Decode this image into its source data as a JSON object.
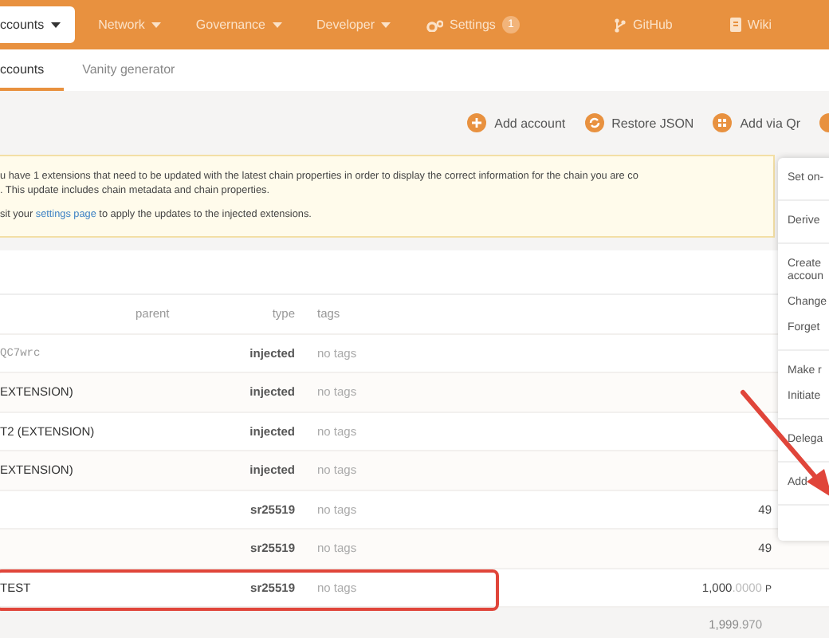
{
  "nav": {
    "items": [
      {
        "label": "ccounts",
        "kind": "dropdown",
        "selected": true
      },
      {
        "label": "Network",
        "kind": "dropdown",
        "selected": false
      },
      {
        "label": "Governance",
        "kind": "dropdown",
        "selected": false
      },
      {
        "label": "Developer",
        "kind": "dropdown",
        "selected": false
      },
      {
        "label": "Settings",
        "kind": "settings",
        "selected": false,
        "badge": "1"
      }
    ],
    "links": [
      {
        "label": "GitHub",
        "kind": "github"
      },
      {
        "label": "Wiki",
        "kind": "wiki"
      }
    ]
  },
  "tabs": [
    {
      "label": "ccounts",
      "selected": true
    },
    {
      "label": "Vanity generator",
      "selected": false
    }
  ],
  "toolbar": [
    {
      "label": "Add account",
      "kind": "plus"
    },
    {
      "label": "Restore JSON",
      "kind": "restore"
    },
    {
      "label": "Add via Qr",
      "kind": "qr"
    },
    {
      "kind": "other"
    }
  ],
  "banner": {
    "lines": [
      "u have 1 extensions that need to be updated with the latest chain properties in order to display the correct information for the chain you are co",
      ". This update includes chain metadata and chain properties."
    ],
    "link_before": "sit your ",
    "link": "settings page",
    "link_after": " to apply the updates to the injected extensions."
  },
  "table": {
    "columns": [
      "parent",
      "type",
      "tags"
    ],
    "rows": [
      {
        "name": "QC7wrc",
        "kind": "address",
        "type": "injected",
        "tags": "no tags",
        "highlighted": false
      },
      {
        "name": "EXTENSION)",
        "kind": "text",
        "type": "injected",
        "tags": "no tags",
        "highlighted": false
      },
      {
        "name": "T2 (EXTENSION)",
        "kind": "text",
        "type": "injected",
        "tags": "no tags",
        "highlighted": false
      },
      {
        "name": "EXTENSION)",
        "kind": "text",
        "type": "injected",
        "tags": "no tags",
        "highlighted": false
      },
      {
        "kind": "empty",
        "type": "sr25519",
        "tags": "no tags",
        "highlighted": false,
        "balance": {
          "whole": "49"
        }
      },
      {
        "kind": "empty",
        "type": "sr25519",
        "tags": "no tags",
        "highlighted": false,
        "balance": {
          "whole": "49"
        }
      },
      {
        "name": "TEST",
        "kind": "text",
        "type": "sr25519",
        "tags": "no tags",
        "highlighted": true,
        "balance": {
          "whole": "1,000",
          "decimals": ".0000",
          "unit": "P"
        }
      }
    ],
    "total": {
      "whole": "1,999",
      "decimals": ".970"
    }
  },
  "menu": {
    "sections": [
      [
        "Set on-"
      ],
      [
        "Derive"
      ],
      [
        "Create accoun",
        "Change",
        "Forget"
      ],
      [
        "Make r",
        "Initiate"
      ],
      [
        "Delega"
      ],
      [
        "Add"
      ]
    ]
  }
}
